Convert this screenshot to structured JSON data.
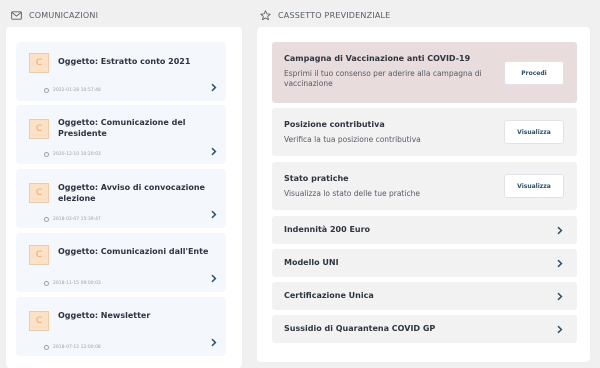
{
  "left_section": {
    "title": "COMUNICAZIONI",
    "icon": "mail-icon"
  },
  "right_section": {
    "title": "CASSETTO PREVIDENZIALE",
    "icon": "star-icon"
  },
  "messages": [
    {
      "avatar": "C",
      "subject": "Oggetto: Estratto conto 2021",
      "date": "2022-01-28 10:57:48"
    },
    {
      "avatar": "C",
      "subject": "Oggetto: Comunicazione del Presidente",
      "date": "2020-12-10 10:20:03"
    },
    {
      "avatar": "C",
      "subject": "Oggetto: Avviso di convocazione elezione",
      "date": "2018-02-07 15:39:47"
    },
    {
      "avatar": "C",
      "subject": "Oggetto: Comunicazioni dall'Ente",
      "date": "2018-11-15 09:00:03"
    },
    {
      "avatar": "C",
      "subject": "Oggetto: Newsletter",
      "date": "2018-07-12 12:00:08"
    }
  ],
  "cassetto": {
    "vaccinazione": {
      "title": "Campagna di Vaccinazione anti COVID-19",
      "desc": "Esprimi il tuo consenso per aderire alla campagna di vaccinazione",
      "button": "Procedi"
    },
    "posizione": {
      "title": "Posizione contributiva",
      "desc": "Verifica la tua posizione contributiva",
      "button": "Visualizza"
    },
    "pratiche": {
      "title": "Stato pratiche",
      "desc": "Visualizza lo stato delle tue pratiche",
      "button": "Visualizza"
    },
    "links": [
      "Indennità 200 Euro",
      "Modello UNI",
      "Certificazione Unica",
      "Sussidio di Quarantena COVID GP"
    ]
  },
  "colors": {
    "chevron": "#2d4f66",
    "avatar_bg": "#fbe1c7",
    "avatar_text": "#f0a45a",
    "highlight": "#e8dcdc"
  }
}
